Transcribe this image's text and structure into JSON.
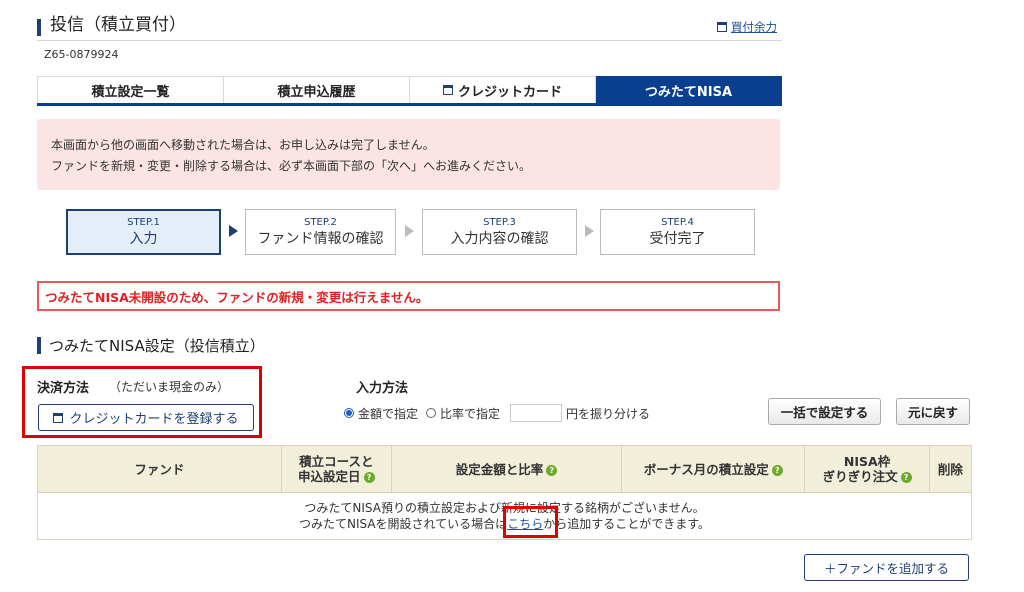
{
  "header": {
    "title": "投信（積立買付）",
    "balance_link": "買付余力",
    "account_id": "Z65-0879924"
  },
  "tabs": [
    {
      "label": "積立設定一覧",
      "active": false
    },
    {
      "label": "積立申込履歴",
      "active": false
    },
    {
      "label": "クレジットカード",
      "active": false,
      "icon": "window-icon"
    },
    {
      "label": "つみたてNISA",
      "active": true
    }
  ],
  "notice": {
    "line1": "本画面から他の画面へ移動された場合は、お申し込みは完了しません。",
    "line2": "ファンドを新規・変更・削除する場合は、必ず本画面下部の「次へ」へお進みください。"
  },
  "steps": [
    {
      "num": "STEP.1",
      "label": "入力",
      "active": true
    },
    {
      "num": "STEP.2",
      "label": "ファンド情報の確認",
      "active": false
    },
    {
      "num": "STEP.3",
      "label": "入力内容の確認",
      "active": false
    },
    {
      "num": "STEP.4",
      "label": "受付完了",
      "active": false
    }
  ],
  "error_message": "つみたてNISA未開設のため、ファンドの新規・変更は行えません。",
  "section": {
    "title": "つみたてNISA設定（投信積立）"
  },
  "payment": {
    "label": "決済方法",
    "sub": "（ただいま現金のみ）",
    "register_card_button": "クレジットカードを登録する"
  },
  "input_method": {
    "label": "入力方法",
    "option_amount": "金額で指定",
    "option_ratio": "比率で指定",
    "selected": "金額で指定",
    "ratio_value": "",
    "ratio_suffix": "円を振り分ける",
    "bulk_button": "一括で設定する",
    "reset_button": "元に戻す"
  },
  "table": {
    "headers": {
      "fund": "ファンド",
      "course_line1": "積立コースと",
      "course_line2": "申込設定日",
      "amount": "設定金額と比率",
      "bonus": "ボーナス月の積立設定",
      "nisa_line1": "NISA枠",
      "nisa_line2": "ぎりぎり注文",
      "delete": "削除"
    },
    "empty_line1": "つみたてNISA預りの積立設定および新規に設定する銘柄がございません。",
    "empty_line2_pre": "つみたてNISAを開設されている場合は",
    "empty_line2_link": "こちら",
    "empty_line2_post": "から追加することができます。"
  },
  "add_fund_button": "＋ファンドを追加する",
  "colors": {
    "navy": "#0a3f8f",
    "notice_bg": "#fce4e4",
    "error": "#e02020",
    "help_icon": "#6cab2a",
    "table_header_bg": "#f1eed9"
  }
}
